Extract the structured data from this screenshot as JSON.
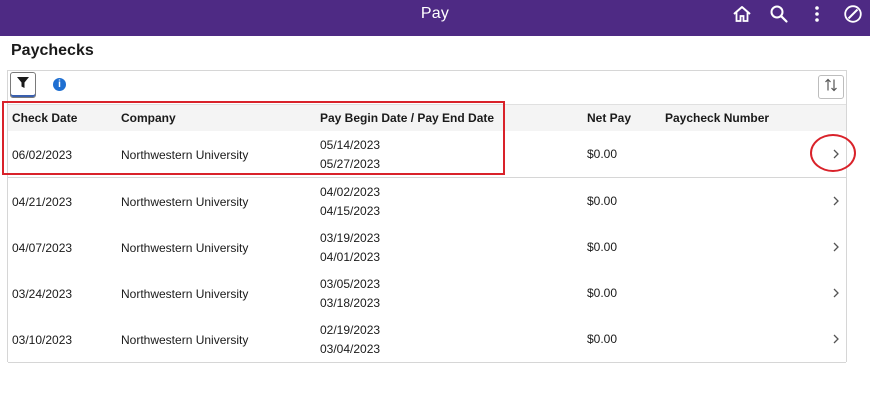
{
  "header": {
    "title": "Pay"
  },
  "page": {
    "title": "Paychecks"
  },
  "toolbar": {
    "info_glyph": "i"
  },
  "columns": {
    "check_date": "Check Date",
    "company": "Company",
    "pay_period": "Pay Begin Date / Pay End Date",
    "net_pay": "Net Pay",
    "paycheck_number": "Paycheck Number"
  },
  "rows": [
    {
      "check_date": "06/02/2023",
      "company": "Northwestern University",
      "begin": "05/14/2023",
      "end": "05/27/2023",
      "net_pay": "$0.00",
      "paycheck_number": ""
    },
    {
      "check_date": "04/21/2023",
      "company": "Northwestern University",
      "begin": "04/02/2023",
      "end": "04/15/2023",
      "net_pay": "$0.00",
      "paycheck_number": ""
    },
    {
      "check_date": "04/07/2023",
      "company": "Northwestern University",
      "begin": "03/19/2023",
      "end": "04/01/2023",
      "net_pay": "$0.00",
      "paycheck_number": ""
    },
    {
      "check_date": "03/24/2023",
      "company": "Northwestern University",
      "begin": "03/05/2023",
      "end": "03/18/2023",
      "net_pay": "$0.00",
      "paycheck_number": ""
    },
    {
      "check_date": "03/10/2023",
      "company": "Northwestern University",
      "begin": "02/19/2023",
      "end": "03/04/2023",
      "net_pay": "$0.00",
      "paycheck_number": ""
    }
  ],
  "icons": {
    "home": "home-icon",
    "search": "search-icon",
    "more": "more-vertical-icon",
    "navbar": "compass-icon",
    "filter": "filter-icon",
    "info": "info-icon",
    "sort": "sort-icon",
    "row_chevron": "chevron-right-icon"
  },
  "colors": {
    "header_bg": "#4e2a84",
    "info_blue": "#1f6fd1",
    "annotation_red": "#d9222a"
  }
}
